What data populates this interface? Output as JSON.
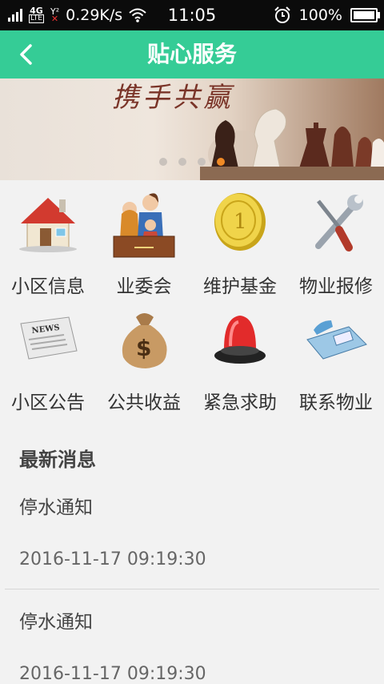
{
  "status_bar": {
    "network": "4G",
    "network_sub": "LTE",
    "sim_label": "Y²",
    "speed": "0.29K/s",
    "time": "11:05",
    "battery": "100%"
  },
  "header": {
    "title": "贴心服务"
  },
  "banner": {
    "text": "携手共赢",
    "slide_count": 4,
    "active_slide": 4
  },
  "services": [
    {
      "label": "小区信息",
      "icon": "house-icon"
    },
    {
      "label": "业委会",
      "icon": "committee-icon"
    },
    {
      "label": "维护基金",
      "icon": "coin-icon"
    },
    {
      "label": "物业报修",
      "icon": "tools-icon"
    },
    {
      "label": "小区公告",
      "icon": "newspaper-icon"
    },
    {
      "label": "公共收益",
      "icon": "money-bag-icon"
    },
    {
      "label": "紧急求助",
      "icon": "alarm-light-icon"
    },
    {
      "label": "联系物业",
      "icon": "telephone-icon"
    }
  ],
  "news": {
    "title": "最新消息",
    "items": [
      {
        "name": "停水通知",
        "date": "2016-11-17 09:19:30"
      },
      {
        "name": "停水通知",
        "date": "2016-11-17 09:19:30"
      }
    ]
  },
  "colors": {
    "primary": "#35cc96",
    "active_dot": "#f08a25"
  }
}
